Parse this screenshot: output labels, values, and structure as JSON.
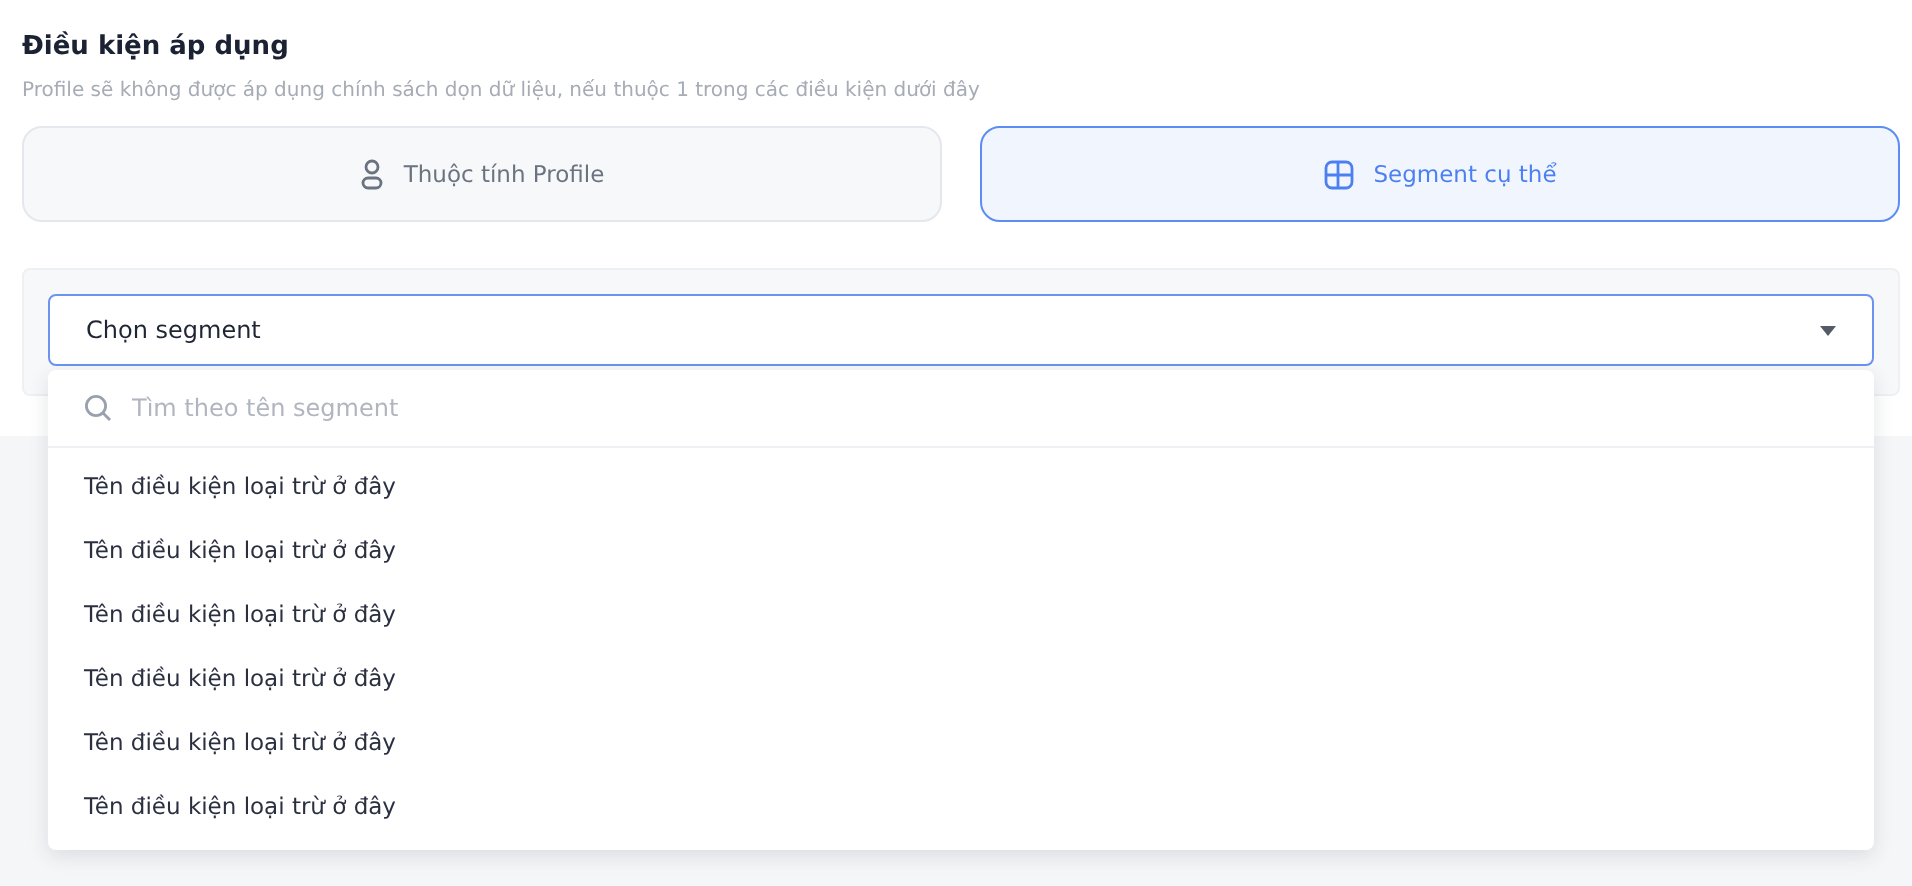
{
  "section": {
    "title": "Điều kiện áp dụng",
    "subtitle": "Profile sẽ không được áp dụng chính sách dọn dữ liệu, nếu thuộc 1 trong các điều kiện dưới đây"
  },
  "tabs": [
    {
      "label": "Thuộc tính Profile",
      "kind": "person",
      "selected": false
    },
    {
      "label": "Segment cụ thể",
      "kind": "segment",
      "selected": true
    }
  ],
  "select": {
    "value": "Chọn segment",
    "expanded": true,
    "search": {
      "placeholder": "Tìm theo tên segment"
    },
    "options": [
      "Tên điều kiện loại trừ ở đây",
      "Tên điều kiện loại trừ ở đây",
      "Tên điều kiện loại trừ ở đây",
      "Tên điều kiện loại trừ ở đây",
      "Tên điều kiện loại trừ ở đây",
      "Tên điều kiện loại trừ ở đây"
    ]
  }
}
